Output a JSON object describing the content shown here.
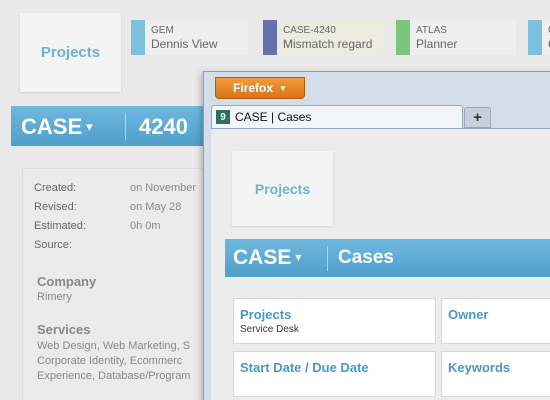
{
  "background": {
    "projects_tile": "Projects",
    "tabs": [
      {
        "code": "GEM",
        "name": "Dennis View"
      },
      {
        "code": "CASE-4240",
        "name": "Mismatch regard"
      },
      {
        "code": "ATLAS",
        "name": "Planner"
      },
      {
        "code": "C",
        "name": "C"
      }
    ],
    "header": {
      "module": "CASE",
      "caret": "▾",
      "number": "4240"
    },
    "meta": {
      "created_label": "Created:",
      "created_value": "on November",
      "revised_label": "Revised:",
      "revised_value": "on May 28",
      "estimated_label": "Estimated:",
      "estimated_value": "0h 0m",
      "source_label": "Source:"
    },
    "company": {
      "label": "Company",
      "value": "Rimery"
    },
    "services": {
      "label": "Services",
      "lines": [
        "Web Design, Web Marketing, S",
        "Corporate Identity, Ecommerc",
        "Experience, Database/Program"
      ]
    }
  },
  "firefox": {
    "menu_button": "Firefox",
    "menu_arrow": "▼",
    "tab": {
      "favicon": "9",
      "title": "CASE | Cases"
    },
    "new_tab": "+",
    "content": {
      "projects_tile": "Projects",
      "header": {
        "module": "CASE",
        "caret": "▾",
        "section": "Cases"
      },
      "fields": {
        "projects": {
          "label": "Projects",
          "value": "Service Desk"
        },
        "owner": {
          "label": "Owner"
        },
        "dates": {
          "label": "Start Date / Due Date"
        },
        "keywords": {
          "label": "Keywords"
        }
      }
    }
  }
}
